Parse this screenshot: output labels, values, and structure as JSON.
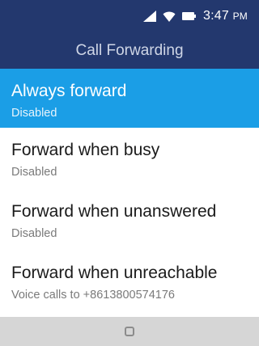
{
  "status_bar": {
    "time": "3:47",
    "ampm": "PM",
    "icons": [
      "signal-icon",
      "wifi-icon",
      "battery-icon"
    ]
  },
  "header": {
    "title": "Call Forwarding"
  },
  "options": [
    {
      "label": "Always forward",
      "status": "Disabled",
      "selected": true
    },
    {
      "label": "Forward when busy",
      "status": "Disabled",
      "selected": false
    },
    {
      "label": "Forward when unanswered",
      "status": "Disabled",
      "selected": false
    },
    {
      "label": "Forward when unreachable",
      "status": "Voice calls to +8613800574176",
      "selected": false
    }
  ],
  "softkeys": {
    "center_icon": "select-square-icon"
  },
  "colors": {
    "header_bg": "#23386e",
    "selection": "#1b9ee6",
    "softkey_bg": "#d6d6d6"
  }
}
